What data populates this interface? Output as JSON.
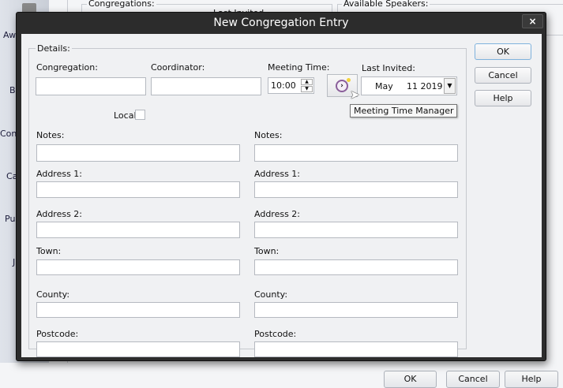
{
  "background": {
    "sidebar": [
      "Aw",
      "B",
      "Con",
      "Ca",
      "Pu",
      "J"
    ],
    "congregations_label": "Congregations:",
    "last_invited_partial": "Last Invited",
    "available_speakers_label": "Available Speakers:",
    "ok": "OK",
    "cancel": "Cancel",
    "help": "Help"
  },
  "dialog": {
    "title": "New Congregation Entry",
    "close": "×",
    "group_label": "Details:",
    "congregation_label": "Congregation:",
    "coordinator_label": "Coordinator:",
    "meeting_time_label": "Meeting Time:",
    "meeting_time_value": "10:00",
    "last_invited_label": "Last Invited:",
    "last_invited_month": "May",
    "last_invited_daydate": "11 2019",
    "local_label": "Local",
    "local_checked": false,
    "tooltip": "Meeting Time Manager",
    "left": {
      "notes": "Notes:",
      "address1": "Address 1:",
      "address2": "Address 2:",
      "town": "Town:",
      "county": "County:",
      "postcode": "Postcode:"
    },
    "right": {
      "notes": "Notes:",
      "address1": "Address 1:",
      "address2": "Address 2:",
      "town": "Town:",
      "county": "County:",
      "postcode": "Postcode:"
    },
    "buttons": {
      "ok": "OK",
      "cancel": "Cancel",
      "help": "Help"
    }
  }
}
